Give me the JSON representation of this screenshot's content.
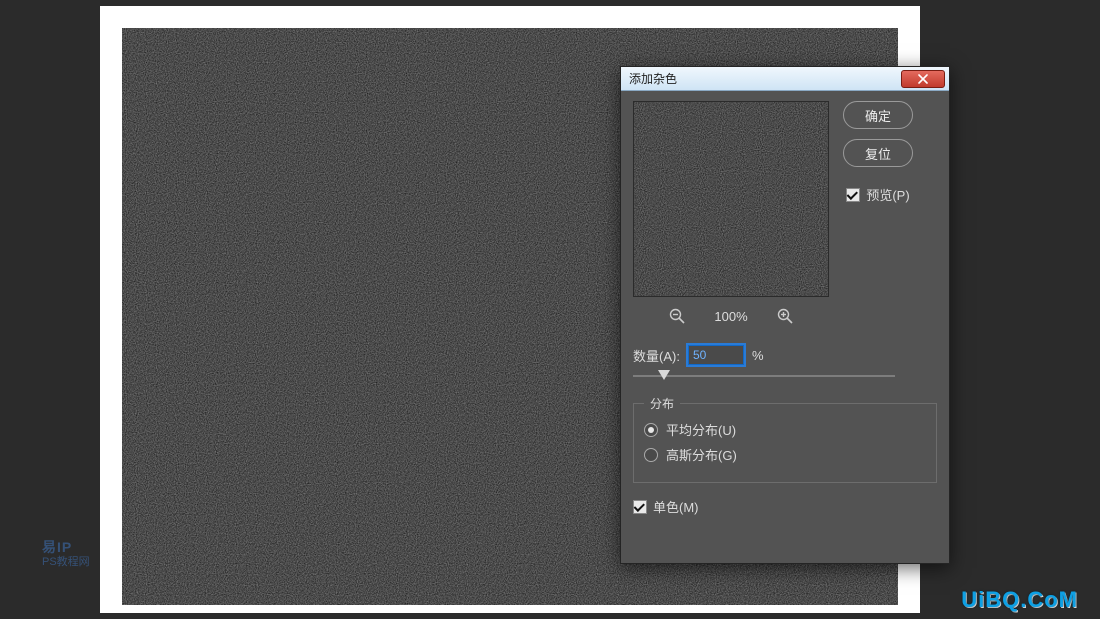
{
  "canvas": {
    "watermark_left_top": "易IP",
    "watermark_left_bottom": "PS教程网",
    "watermark_right": "UiBQ.CoM"
  },
  "dialog": {
    "title": "添加杂色",
    "ok_label": "确定",
    "reset_label": "复位",
    "preview_label": "预览(P)",
    "preview_checked": true,
    "zoom_level": "100%",
    "amount_label": "数量(A):",
    "amount_value": "50",
    "amount_unit": "%",
    "amount_slider_percent": 12,
    "distribution": {
      "legend": "分布",
      "uniform_label": "平均分布(U)",
      "gaussian_label": "高斯分布(G)",
      "selected": "uniform"
    },
    "monochrome_label": "单色(M)",
    "monochrome_checked": true
  }
}
